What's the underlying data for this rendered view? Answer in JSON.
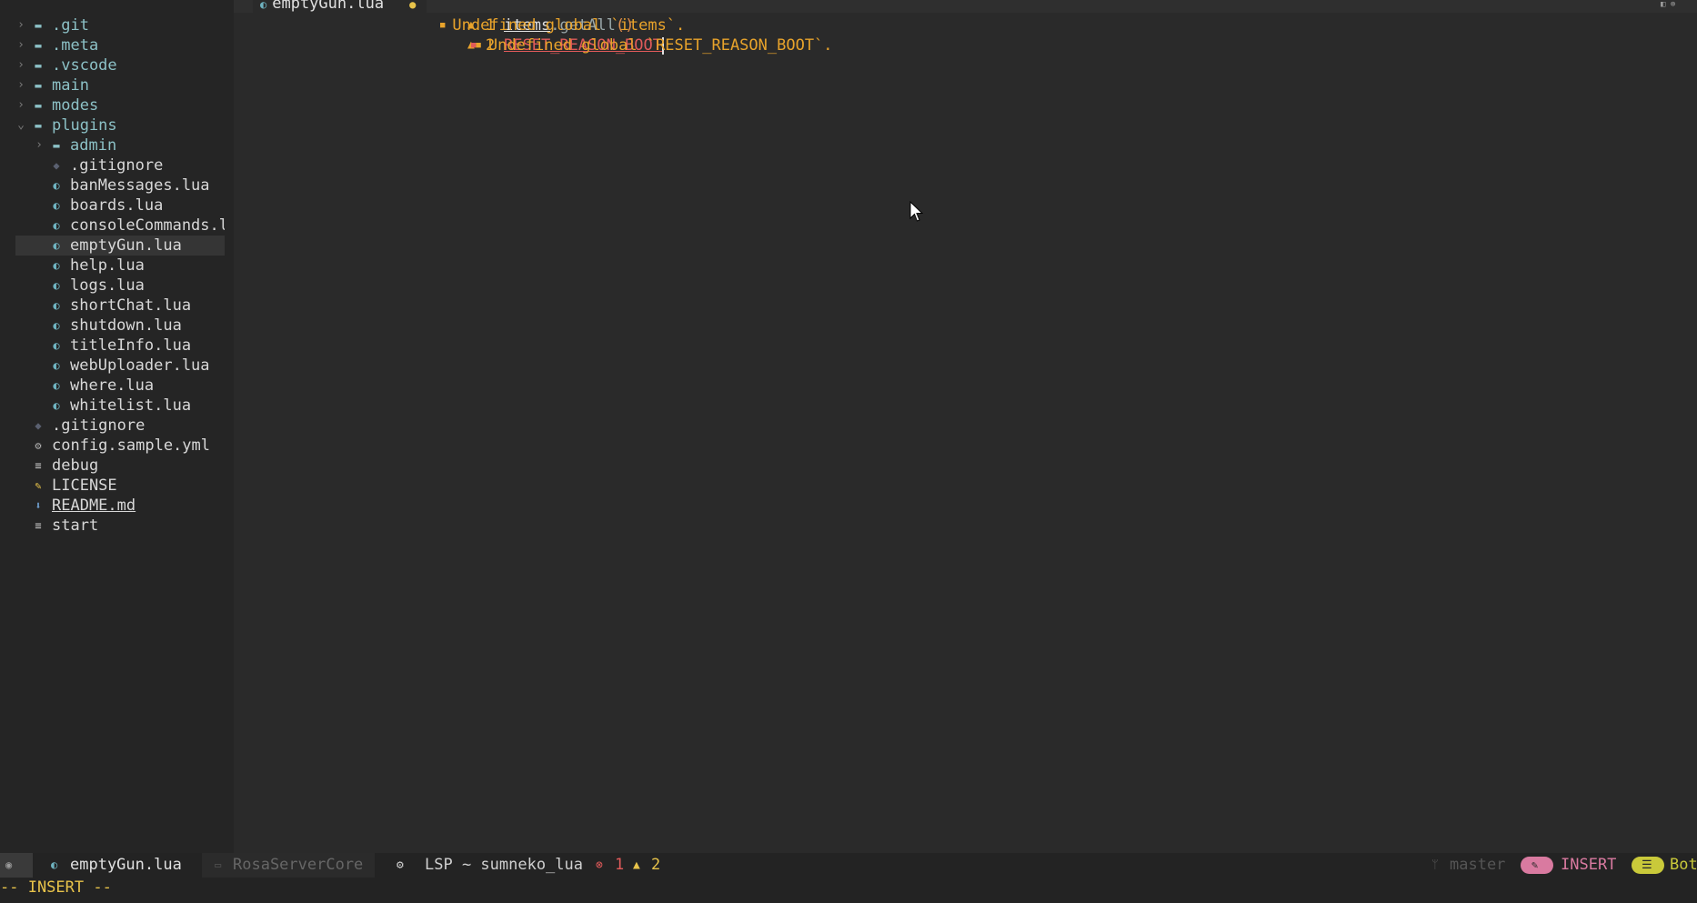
{
  "tab": {
    "filename": "emptyGun.lua",
    "modified_marker": "●"
  },
  "tree": [
    {
      "type": "dir",
      "name": ".git",
      "depth": 0,
      "expanded": false
    },
    {
      "type": "dir",
      "name": ".meta",
      "depth": 0,
      "expanded": false
    },
    {
      "type": "dir",
      "name": ".vscode",
      "depth": 0,
      "expanded": false
    },
    {
      "type": "dir",
      "name": "main",
      "depth": 0,
      "expanded": false
    },
    {
      "type": "dir",
      "name": "modes",
      "depth": 0,
      "expanded": false
    },
    {
      "type": "dir",
      "name": "plugins",
      "depth": 0,
      "expanded": true
    },
    {
      "type": "dir",
      "name": "admin",
      "depth": 1,
      "expanded": false
    },
    {
      "type": "git",
      "name": ".gitignore",
      "depth": 1
    },
    {
      "type": "lua",
      "name": "banMessages.lua",
      "depth": 1
    },
    {
      "type": "lua",
      "name": "boards.lua",
      "depth": 1
    },
    {
      "type": "lua",
      "name": "consoleCommands.l",
      "depth": 1
    },
    {
      "type": "lua",
      "name": "emptyGun.lua",
      "depth": 1,
      "active": true
    },
    {
      "type": "lua",
      "name": "help.lua",
      "depth": 1
    },
    {
      "type": "lua",
      "name": "logs.lua",
      "depth": 1
    },
    {
      "type": "lua",
      "name": "shortChat.lua",
      "depth": 1
    },
    {
      "type": "lua",
      "name": "shutdown.lua",
      "depth": 1
    },
    {
      "type": "lua",
      "name": "titleInfo.lua",
      "depth": 1
    },
    {
      "type": "lua",
      "name": "webUploader.lua",
      "depth": 1
    },
    {
      "type": "lua",
      "name": "where.lua",
      "depth": 1
    },
    {
      "type": "lua",
      "name": "whitelist.lua",
      "depth": 1
    },
    {
      "type": "git",
      "name": ".gitignore",
      "depth": 0
    },
    {
      "type": "cfg",
      "name": "config.sample.yml",
      "depth": 0
    },
    {
      "type": "txt",
      "name": "debug",
      "depth": 0
    },
    {
      "type": "lic",
      "name": "LICENSE",
      "depth": 0
    },
    {
      "type": "md",
      "name": "README.md",
      "depth": 0
    },
    {
      "type": "txt",
      "name": "start",
      "depth": 0
    }
  ],
  "code": {
    "line1": {
      "num": "1",
      "ident": "items",
      "dot": ".",
      "func": "getAll",
      "paren": "()",
      "diag": "Undefined global `items`."
    },
    "line2": {
      "num": "2",
      "ident": "RESET_REASON_BOOT",
      "diag": "Undefined global `RESET_REASON_BOOT`."
    }
  },
  "status": {
    "filename": "emptyGun.lua",
    "project": "RosaServerCore",
    "lsp": "LSP ~ sumneko_lua",
    "errors": "1",
    "warnings": "2",
    "branch": "master",
    "mode": "INSERT",
    "position": "Bot"
  },
  "cmdline": "-- INSERT --",
  "colors": {
    "background": "#2a2a2a",
    "sidebar": "#252525",
    "directory": "#8cc1c6",
    "warning": "#e8a32b",
    "error": "#e05a5a",
    "mode_pill": "#d97aa0",
    "bot_pill": "#c9c93a"
  }
}
